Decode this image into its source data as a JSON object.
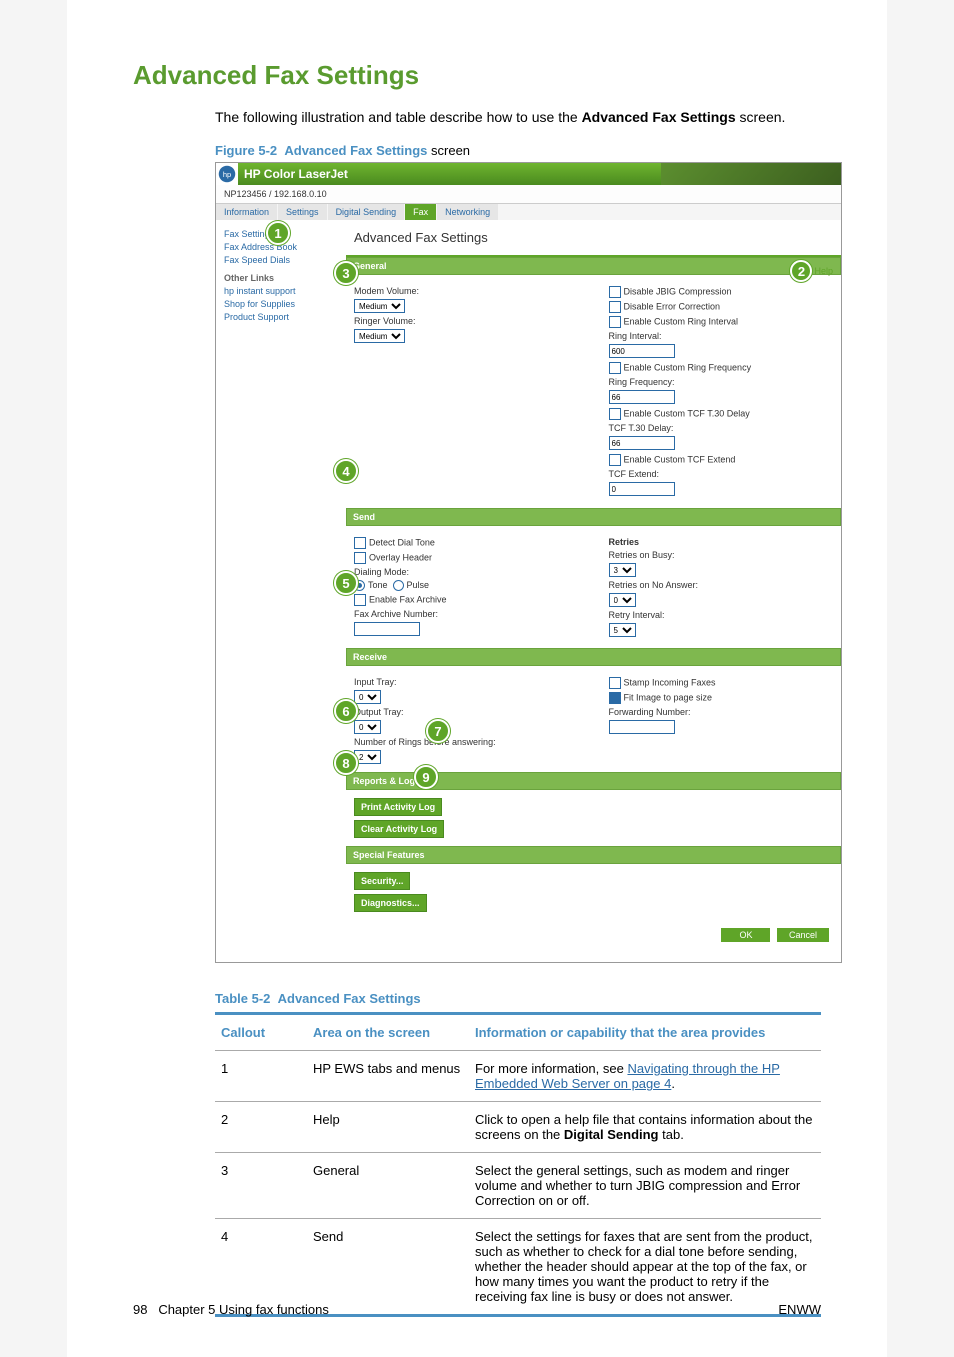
{
  "heading": "Advanced Fax Settings",
  "intro_pre": "The following illustration and table describe how to use the ",
  "intro_bold": "Advanced Fax Settings",
  "intro_post": " screen.",
  "figure": {
    "label": "Figure 5-2",
    "title": "Advanced Fax Settings",
    "suffix": " screen"
  },
  "screenshot": {
    "header_title": "HP Color LaserJet",
    "subheader": "NP123456 / 192.168.0.10",
    "tabs": [
      "Information",
      "Settings",
      "Digital Sending",
      "Fax",
      "Networking"
    ],
    "active_tab": "Fax",
    "sidebar": {
      "items": [
        "Fax Settings",
        "Fax Address Book",
        "Fax Speed Dials"
      ],
      "other_label": "Other Links",
      "other": [
        "hp instant support",
        "Shop for Supplies",
        "Product Support"
      ]
    },
    "main_title": "Advanced Fax Settings",
    "help_label": "Help",
    "general": {
      "title": "General",
      "modem_label": "Modem Volume:",
      "modem_val": "Medium",
      "ringer_label": "Ringer Volume:",
      "ringer_val": "Medium",
      "opts": {
        "jbig": "Disable JBIG Compression",
        "err": "Disable Error Correction",
        "cri": "Enable Custom Ring Interval",
        "cri_label": "Ring Interval:",
        "cri_val": "600",
        "crf": "Enable Custom Ring Frequency",
        "crf_label": "Ring Frequency:",
        "crf_val": "66",
        "tcf": "Enable Custom TCF T.30 Delay",
        "tcf_label": "TCF T.30 Delay:",
        "tcf_val": "66",
        "tce": "Enable Custom TCF Extend",
        "tce_label": "TCF Extend:",
        "tce_val": "0"
      }
    },
    "send": {
      "title": "Send",
      "detect": "Detect Dial Tone",
      "overlay": "Overlay Header",
      "dial_label": "Dialing Mode:",
      "tone": "Tone",
      "pulse": "Pulse",
      "enable_arch": "Enable Fax Archive",
      "arch_label": "Fax Archive Number:",
      "retries_hdr": "Retries",
      "busy_label": "Retries on Busy:",
      "busy_val": "3",
      "noans_label": "Retries on No Answer:",
      "noans_val": "0",
      "retryint_label": "Retry Interval:",
      "retryint_val": "5"
    },
    "receive": {
      "title": "Receive",
      "input_label": "Input Tray:",
      "input_val": "0",
      "output_label": "Output Tray:",
      "output_val": "0",
      "rings_label": "Number of Rings before answering:",
      "rings_val": "2",
      "stamp": "Stamp Incoming Faxes",
      "fit": "Fit Image to page size",
      "fwd_label": "Forwarding Number:"
    },
    "reports_title": "Reports & Logs",
    "buttons": {
      "print": "Print Activity Log",
      "clear": "Clear Activity Log"
    },
    "special_title": "Special Features",
    "special": {
      "sec": "Security...",
      "diag": "Diagnostics..."
    },
    "ok": "OK",
    "cancel": "Cancel"
  },
  "table": {
    "label": "Table 5-2",
    "title": "Advanced Fax Settings",
    "cols": [
      "Callout",
      "Area on the screen",
      "Information or capability that the area provides"
    ],
    "rows": [
      {
        "c": "1",
        "a": "HP EWS tabs and menus",
        "d_pre": "For more information, see ",
        "d_link": "Navigating through the HP Embedded Web Server on page 4",
        "d_post": "."
      },
      {
        "c": "2",
        "a": "Help",
        "d": "Click to open a help file that contains information about the screens on the Digital Sending tab.",
        "bold": "Digital Sending"
      },
      {
        "c": "3",
        "a": "General",
        "d": "Select the general settings, such as modem and ringer volume and whether to turn JBIG compression and Error Correction on or off."
      },
      {
        "c": "4",
        "a": "Send",
        "d": "Select the settings for faxes that are sent from the product, such as whether to check for a dial tone before sending, whether the header should appear at the top of the fax, or how many times you want the product to retry if the receiving fax line is busy or does not answer."
      }
    ]
  },
  "footer": {
    "page": "98",
    "chapter": "Chapter 5   Using fax functions",
    "right": "ENWW"
  }
}
